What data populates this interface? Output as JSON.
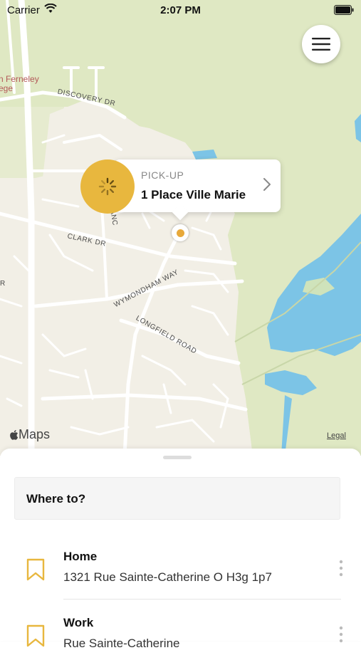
{
  "status_bar": {
    "carrier": "Carrier",
    "time": "2:07 PM"
  },
  "map": {
    "labels": {
      "discovery": "DISCOVERY DR",
      "clark": "CLARK DR",
      "torrance": "TORRANC",
      "wymondham": "WYMONDHAM WAY",
      "longfield": "LONGFIELD ROAD",
      "college_line1": "n Ferneley",
      "college_line2": "ege",
      "edge_r": "R"
    },
    "attribution": "Maps",
    "legal": "Legal",
    "colors": {
      "land": "#f2efe6",
      "park": "#dfe8c3",
      "water": "#7cc4e6",
      "road": "#ffffff",
      "accent": "#e8b73e"
    }
  },
  "pickup": {
    "label": "PICK-UP",
    "address": "1 Place Ville Marie"
  },
  "sheet": {
    "search_placeholder": "Where to?",
    "places": [
      {
        "title": "Home",
        "address": "1321 Rue Sainte-Catherine O H3g 1p7",
        "icon": "bookmark-icon"
      },
      {
        "title": "Work",
        "address": "Rue Sainte-Catherine",
        "icon": "bookmark-icon"
      }
    ]
  },
  "icons": {
    "menu": "hamburger-icon",
    "spinner": "spinner-icon",
    "more": "more-vertical-icon",
    "wifi": "wifi-icon",
    "battery": "battery-icon",
    "chevron": "chevron-right-icon"
  }
}
